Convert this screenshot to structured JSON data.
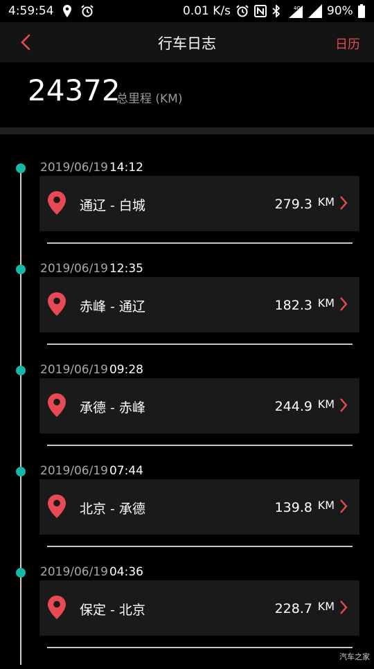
{
  "status_bar": {
    "time": "4:59:54",
    "net_speed": "0.01 K/s",
    "network_type": "4G",
    "battery": "90%",
    "icons": [
      "location-icon",
      "alarm-icon",
      "nfc-icon",
      "bluetooth-icon",
      "signal-icon",
      "battery-icon"
    ]
  },
  "header": {
    "title": "行车日志",
    "calendar_label": "日历"
  },
  "summary": {
    "total_value": "24372",
    "total_label": "总里程 (KM)"
  },
  "entries": [
    {
      "date": "2019/06/19",
      "time": "14:12",
      "route": "通辽 - 白城",
      "distance": "279.3",
      "unit": "KM"
    },
    {
      "date": "2019/06/19",
      "time": "12:35",
      "route": "赤峰 - 通辽",
      "distance": "182.3",
      "unit": "KM"
    },
    {
      "date": "2019/06/19",
      "time": "09:28",
      "route": "承德 - 赤峰",
      "distance": "244.9",
      "unit": "KM"
    },
    {
      "date": "2019/06/19",
      "time": "07:44",
      "route": "北京 - 承德",
      "distance": "139.8",
      "unit": "KM"
    },
    {
      "date": "2019/06/19",
      "time": "04:36",
      "route": "保定 - 北京",
      "distance": "228.7",
      "unit": "KM"
    }
  ],
  "colors": {
    "accent": "#e84a55",
    "timeline_dot": "#14b8a6",
    "card_bg": "#1a1a1a"
  },
  "watermark": "汽车之家"
}
